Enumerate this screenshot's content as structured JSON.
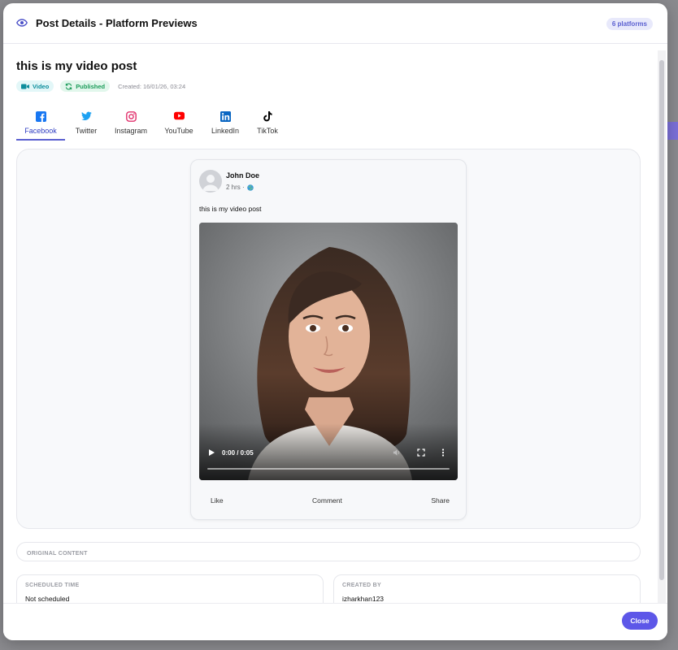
{
  "header": {
    "title": "Post Details - Platform Previews",
    "platform_count": "6 platforms"
  },
  "post": {
    "title": "this is my video post",
    "type_badge": "Video",
    "status_badge": "Published",
    "created": "Created: 16/01/26, 03:24"
  },
  "tabs": [
    {
      "label": "Facebook",
      "icon": "facebook-icon",
      "active": true
    },
    {
      "label": "Twitter",
      "icon": "twitter-icon"
    },
    {
      "label": "Instagram",
      "icon": "instagram-icon"
    },
    {
      "label": "YouTube",
      "icon": "youtube-icon"
    },
    {
      "label": "LinkedIn",
      "icon": "linkedin-icon"
    },
    {
      "label": "TikTok",
      "icon": "tiktok-icon"
    }
  ],
  "preview": {
    "author": "John Doe",
    "time": "2 hrs ·",
    "text": "this is my video post",
    "video_time": "0:00 / 0:05",
    "video_progress": 0,
    "actions": {
      "like": "Like",
      "comment": "Comment",
      "share": "Share"
    }
  },
  "original_content": {
    "label": "ORIGINAL CONTENT"
  },
  "scheduled": {
    "label": "SCHEDULED TIME",
    "value": "Not scheduled"
  },
  "created_by": {
    "label": "CREATED BY",
    "value": "izharkhan123"
  },
  "footer": {
    "close_label": "Close"
  },
  "colors": {
    "accent": "#5d57e8",
    "facebook": "#1877f2",
    "twitter": "#1da1f2",
    "instagram": "#e1306c",
    "youtube": "#ff0000",
    "linkedin": "#0a66c2",
    "tiktok": "#000000",
    "video_badge": "#0b8d9c",
    "published_badge": "#1a9b58"
  }
}
